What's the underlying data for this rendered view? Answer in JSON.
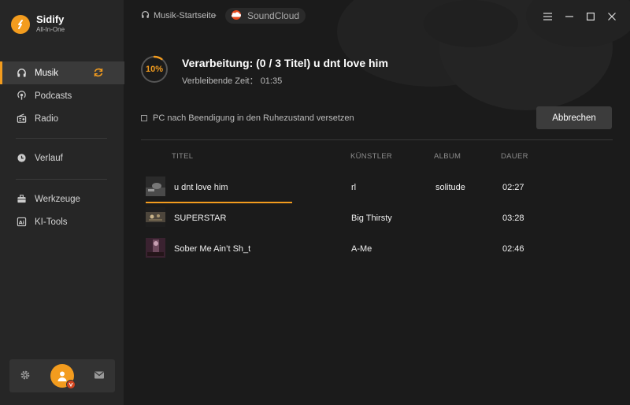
{
  "app": {
    "name": "Sidify",
    "subtitle": "All-In-One"
  },
  "sidebar": {
    "items": [
      {
        "label": "Musik",
        "icon": "headphones-icon",
        "active": true
      },
      {
        "label": "Podcasts",
        "icon": "podcast-icon"
      },
      {
        "label": "Radio",
        "icon": "radio-icon"
      },
      {
        "label": "Verlauf",
        "icon": "clock-icon"
      },
      {
        "label": "Werkzeuge",
        "icon": "toolbox-icon"
      },
      {
        "label": "KI-Tools",
        "icon": "ai-icon"
      }
    ]
  },
  "breadcrumb": {
    "home": "Musik-Startseite",
    "source": "SoundCloud"
  },
  "processing": {
    "percent": "10%",
    "progress_value": 10,
    "title": "Verarbeitung: (0 / 3 Titel) u dnt love him",
    "remaining_label": "Verbleibende Zeit：",
    "remaining_time": "01:35"
  },
  "options": {
    "sleep_label": "PC nach Beendigung in den Ruhezustand versetzen",
    "cancel_label": "Abbrechen"
  },
  "table": {
    "headers": {
      "title": "TITEL",
      "artist": "KÜNSTLER",
      "album": "ALBUM",
      "duration": "DAUER"
    },
    "rows": [
      {
        "title": "u dnt love him",
        "artist": "rl",
        "album": "solitude",
        "duration": "02:27",
        "row_progress": 0.35
      },
      {
        "title": "SUPERSTAR",
        "artist": "Big Thirsty",
        "album": "",
        "duration": "03:28"
      },
      {
        "title": "Sober Me Ain’t Sh_t",
        "artist": "A-Me",
        "album": "",
        "duration": "02:46"
      }
    ]
  },
  "colors": {
    "accent": "#f39c1e",
    "background": "#1b1b1b",
    "sidebar": "#262626"
  }
}
